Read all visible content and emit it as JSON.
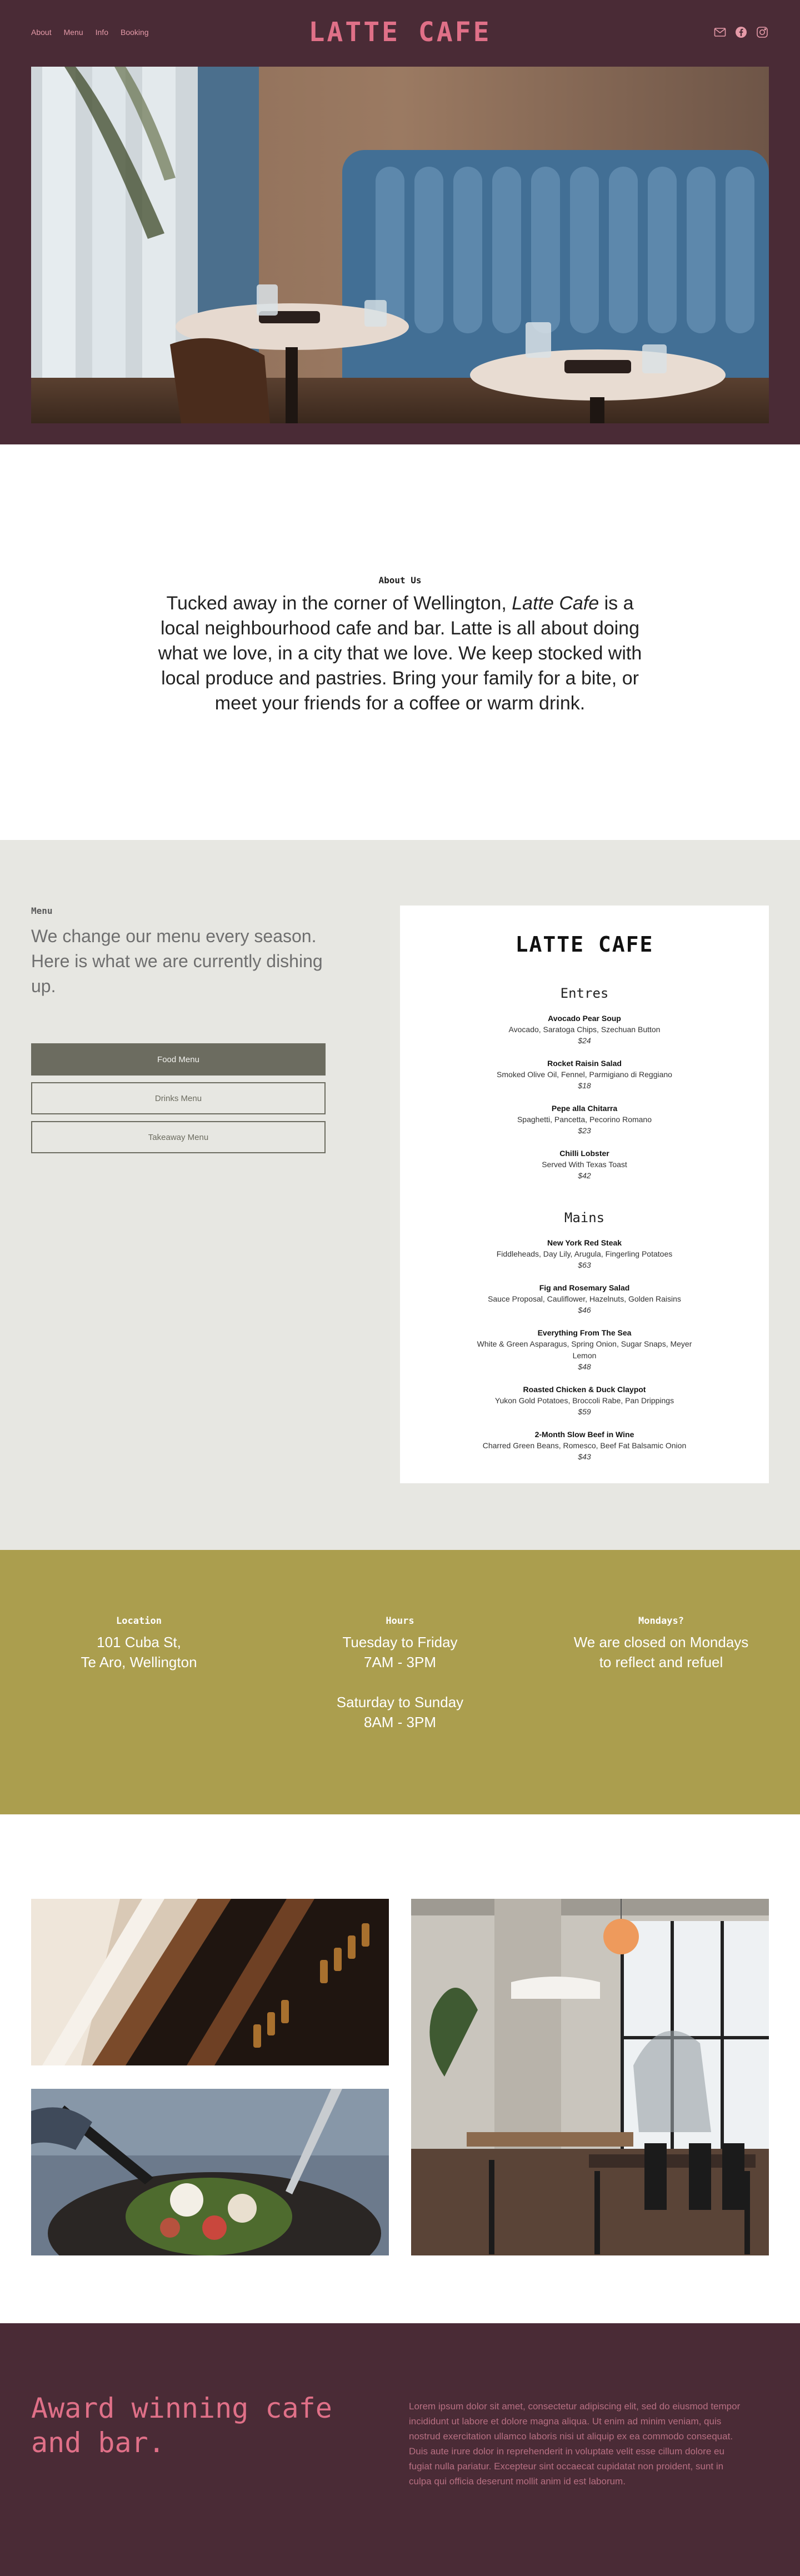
{
  "header": {
    "nav": [
      "About",
      "Menu",
      "Info",
      "Booking"
    ],
    "brand": "LATTE CAFE",
    "social_icons": [
      "email-icon",
      "facebook-icon",
      "instagram-icon"
    ]
  },
  "about": {
    "heading": "About Us",
    "text_before": "Tucked away in the corner of Wellington, ",
    "text_em": "Latte Cafe",
    "text_after": " is a local neighbourhood cafe and bar. Latte is all about doing what we love, in a city that we love. We keep stocked with local produce and pastries. Bring your family for a bite, or meet your friends for a coffee or warm drink."
  },
  "menu_section": {
    "heading": "Menu",
    "lead": "We change our menu every season. Here is what we are currently dishing up.",
    "buttons": [
      "Food Menu",
      "Drinks Menu",
      "Takeaway Menu"
    ],
    "card": {
      "title": "LATTE CAFE",
      "groups": [
        {
          "name": "Entres",
          "items": [
            {
              "name": "Avocado Pear Soup",
              "desc": "Avocado, Saratoga Chips, Szechuan Button",
              "price": "$24"
            },
            {
              "name": "Rocket Raisin Salad",
              "desc": "Smoked Olive Oil, Fennel, Parmigiano di Reggiano",
              "price": "$18"
            },
            {
              "name": "Pepe alla Chitarra",
              "desc": "Spaghetti, Pancetta, Pecorino Romano",
              "price": "$23"
            },
            {
              "name": "Chilli Lobster",
              "desc": "Served With Texas Toast",
              "price": "$42"
            }
          ]
        },
        {
          "name": "Mains",
          "items": [
            {
              "name": "New York Red Steak",
              "desc": "Fiddleheads, Day Lily, Arugula, Fingerling Potatoes",
              "price": "$63"
            },
            {
              "name": "Fig and Rosemary Salad",
              "desc": "Sauce Proposal, Cauliflower, Hazelnuts, Golden Raisins",
              "price": "$46"
            },
            {
              "name": "Everything From The Sea",
              "desc": "White & Green Asparagus, Spring Onion, Sugar Snaps, Meyer Lemon",
              "price": "$48"
            },
            {
              "name": "Roasted Chicken & Duck Claypot",
              "desc": "Yukon Gold Potatoes, Broccoli Rabe, Pan Drippings",
              "price": "$59"
            },
            {
              "name": "2-Month Slow Beef in Wine",
              "desc": "Charred Green Beans, Romesco, Beef Fat Balsamic Onion",
              "price": "$43"
            }
          ]
        }
      ]
    }
  },
  "info": {
    "location": {
      "heading": "Location",
      "lines": [
        "101 Cuba St,",
        "Te Aro, Wellington"
      ]
    },
    "hours": {
      "heading": "Hours",
      "line1": "Tuesday to Friday",
      "line2": "7AM - 3PM",
      "line3": "Saturday to Sunday",
      "line4": "8AM - 3PM"
    },
    "mondays": {
      "heading": "Mondays?",
      "lines": [
        "We are closed on Mondays",
        "to reflect and refuel"
      ]
    }
  },
  "footer": {
    "award": "Award winning cafe and bar.",
    "lorem": "Lorem ipsum dolor sit amet, consectetur adipiscing elit, sed do eiusmod tempor incididunt ut labore et dolore magna aliqua. Ut enim ad minim veniam, quis nostrud exercitation ullamco laboris nisi ut aliquip ex ea commodo consequat. Duis aute irure dolor in reprehenderit in voluptate velit esse cillum dolore eu fugiat nulla pariatur. Excepteur sint occaecat cupidatat non proident, sunt in culpa qui officia deserunt mollit anim id est laborum."
  },
  "colors": {
    "plum": "#4a2b36",
    "pink": "#e07088",
    "olive": "#ab9e4e",
    "stone": "#e7e7e2",
    "button": "#6c6c60"
  }
}
